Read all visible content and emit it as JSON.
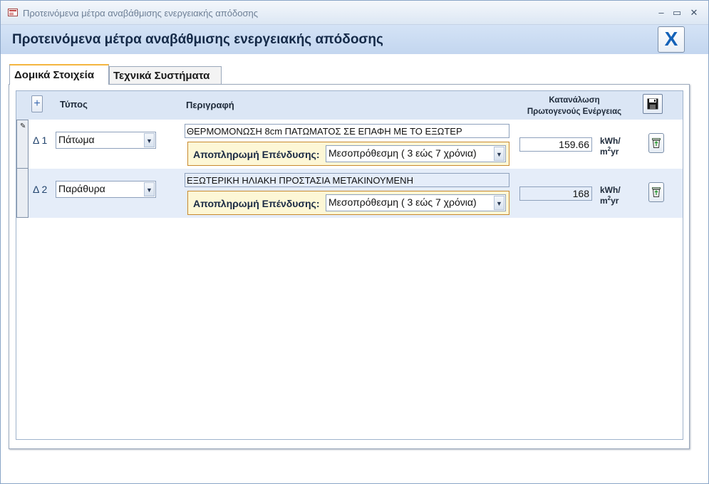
{
  "window": {
    "title": "Προτεινόμενα μέτρα αναβάθμισης ενεργειακής απόδοσης",
    "minimize": "–",
    "restore": "▭",
    "close": "✕"
  },
  "header": {
    "title": "Προτεινόμενα μέτρα αναβάθμισης ενεργειακής απόδοσης",
    "close_label": "X"
  },
  "tabs": [
    {
      "label": "Δομικά Στοιχεία",
      "active": true
    },
    {
      "label": "Τεχνικά Συστήματα",
      "active": false
    }
  ],
  "grid": {
    "add_label": "+",
    "columns": {
      "type": "Τύπος",
      "description": "Περιγραφή",
      "consumption_line1": "Κατανάλωση",
      "consumption_line2": "Πρωτογενούς Ενέργειας"
    },
    "payback_label": "Αποπληρωμή Επένδυσης:",
    "unit_top": "kWh/",
    "unit_bottom_base": "m",
    "unit_bottom_sup": "2",
    "unit_bottom_rest": "yr",
    "rows": [
      {
        "label": "Δ 1",
        "type": "Πάτωμα",
        "description": "ΘΕΡΜΟΜΟΝΩΣΗ 8cm ΠΑΤΩΜΑΤΟΣ  ΣΕ ΕΠΑΦΗ ΜΕ ΤΟ ΕΞΩΤΕΡ",
        "payback": "Μεσοπρόθεσμη ( 3 εώς 7 χρόνια)",
        "consumption": "159.66"
      },
      {
        "label": "Δ 2",
        "type": "Παράθυρα",
        "description": "ΕΞΩΤΕΡΙΚΗ ΗΛΙΑΚΗ ΠΡΟΣΤΑΣΙΑ ΜΕΤΑΚΙΝΟΥΜΕΝΗ",
        "payback": "Μεσοπρόθεσμη ( 3 εώς 7 χρόνια)",
        "consumption": "168"
      }
    ]
  },
  "icons": {
    "app": "form-icon",
    "save": "floppy-disk-icon",
    "delete": "recycle-bin-icon",
    "edit": "pencil-icon",
    "dropdown": "chevron-down-icon"
  },
  "colors": {
    "header_band": "#c3d6ef",
    "row_alt": "#e5edf9",
    "payback_border": "#c98a2e",
    "payback_fill": "#fdf7d6",
    "close_x": "#1462b8",
    "active_tab_accent": "#f4b53f"
  }
}
